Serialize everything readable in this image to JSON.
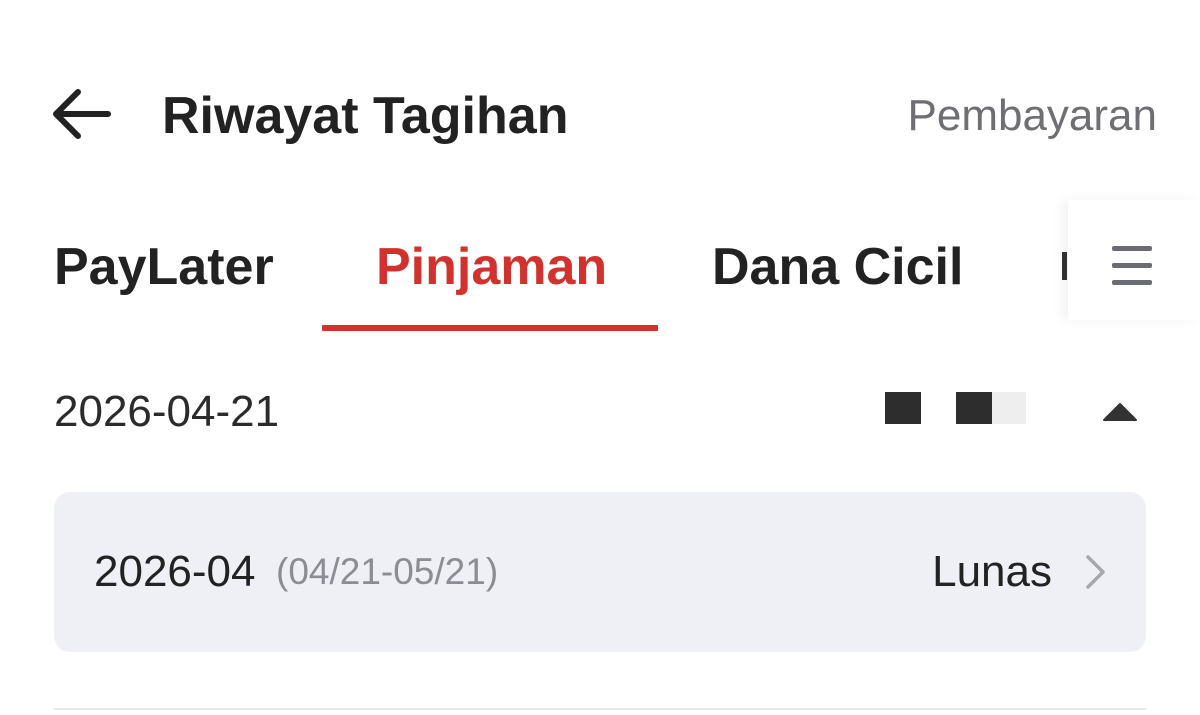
{
  "header": {
    "title": "Riwayat Tagihan",
    "action_label": "Pembayaran"
  },
  "tabs": [
    {
      "label": "PayLater",
      "active": false
    },
    {
      "label": "Pinjaman",
      "active": true
    },
    {
      "label": "Dana Cicil",
      "active": false
    }
  ],
  "group": {
    "date": "2026-04-21",
    "expanded": true
  },
  "bills": [
    {
      "month": "2026-04",
      "range": "(04/21-05/21)",
      "status": "Lunas"
    }
  ],
  "colors": {
    "accent": "#d2322d",
    "card_background": "#eef0f5",
    "muted_text": "#8c8c94"
  },
  "icons": {
    "back": "arrow-left-icon",
    "menu": "hamburger-menu-icon",
    "collapse": "caret-up-icon",
    "chevron": "chevron-right-icon"
  }
}
